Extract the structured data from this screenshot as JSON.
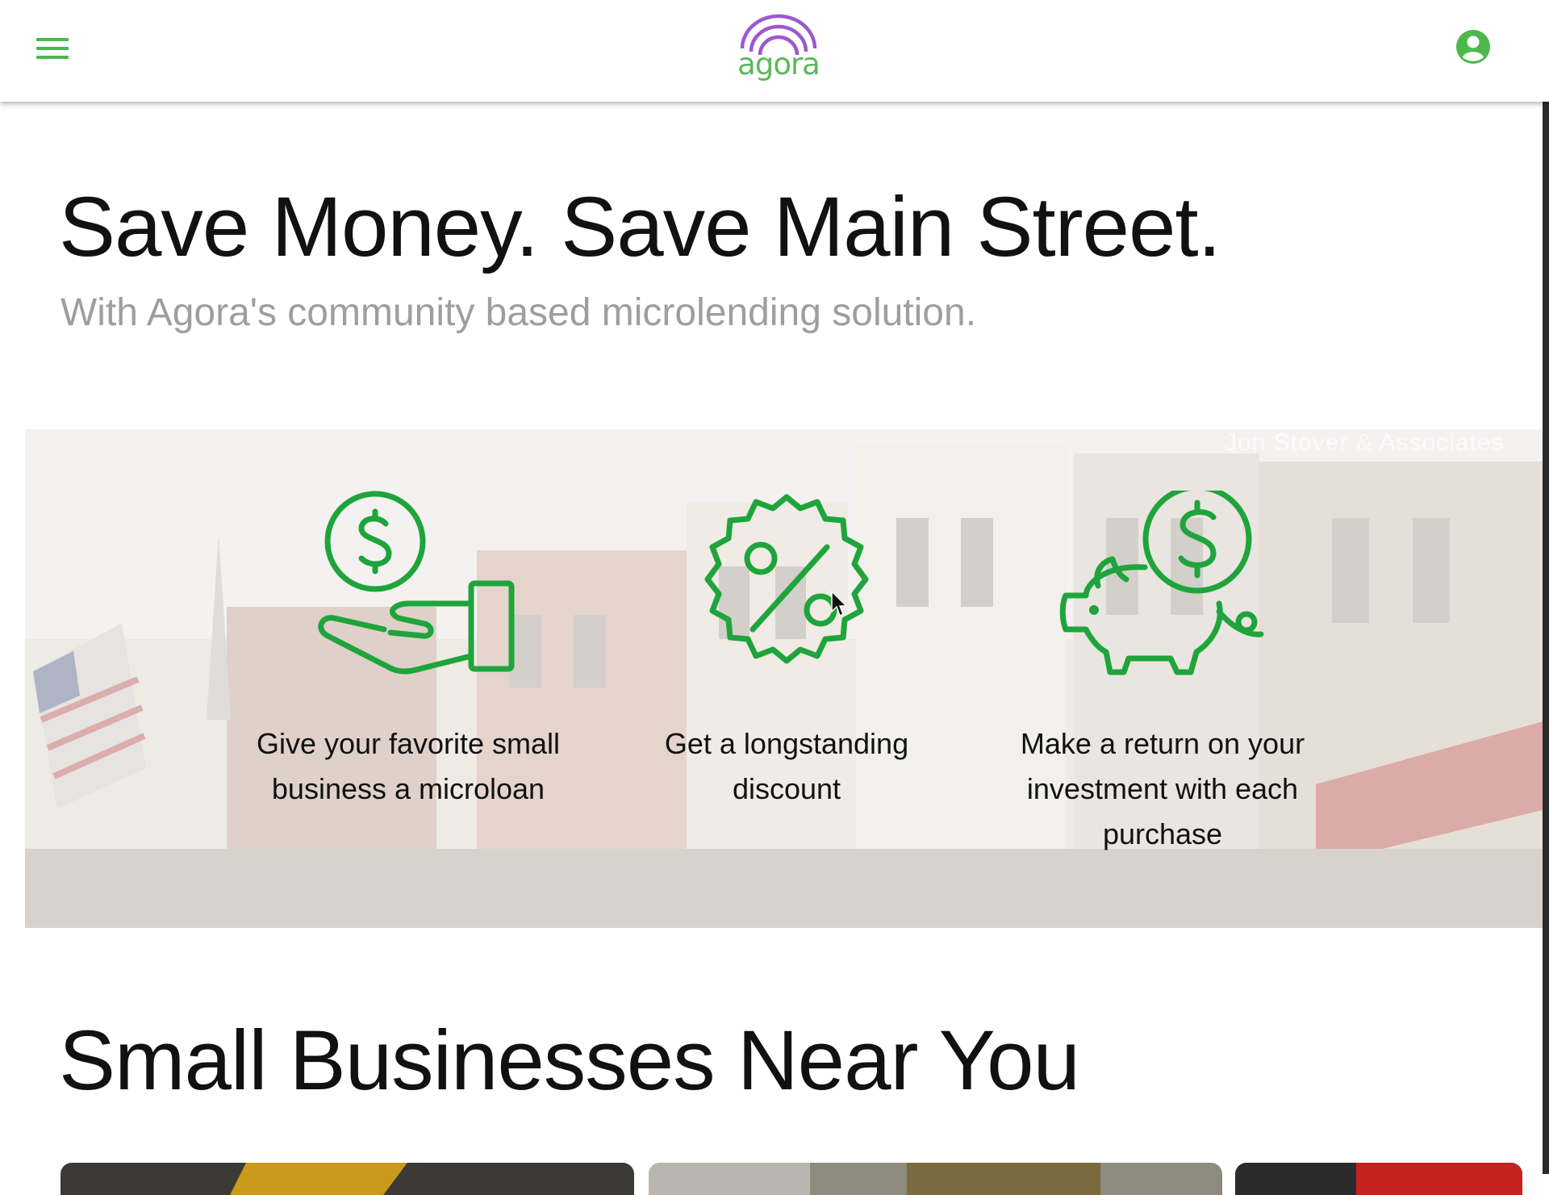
{
  "header": {
    "menu_icon": "hamburger-menu-icon",
    "logo_text": "agora",
    "account_icon": "user-circle-icon",
    "colors": {
      "brand_green": "#4cb84c",
      "logo_purple": "#9b59d0"
    }
  },
  "hero": {
    "title": "Save Money. Save Main Street.",
    "subtitle": "With Agora's community based microlending solution."
  },
  "banner": {
    "watermark": "Jon Stover & Associates",
    "features": [
      {
        "icon": "hand-with-dollar-coin-icon",
        "text": "Give your favorite small business a microloan"
      },
      {
        "icon": "percent-badge-icon",
        "text": "Get a longstanding discount"
      },
      {
        "icon": "piggy-bank-dollar-icon",
        "text": "Make a return on your investment with each purchase"
      }
    ],
    "icon_color": "#1fa43c"
  },
  "businesses_section": {
    "title": "Small Businesses Near You",
    "cards": [
      {
        "name": "business-card-1"
      },
      {
        "name": "business-card-2"
      },
      {
        "name": "business-card-3"
      }
    ]
  }
}
